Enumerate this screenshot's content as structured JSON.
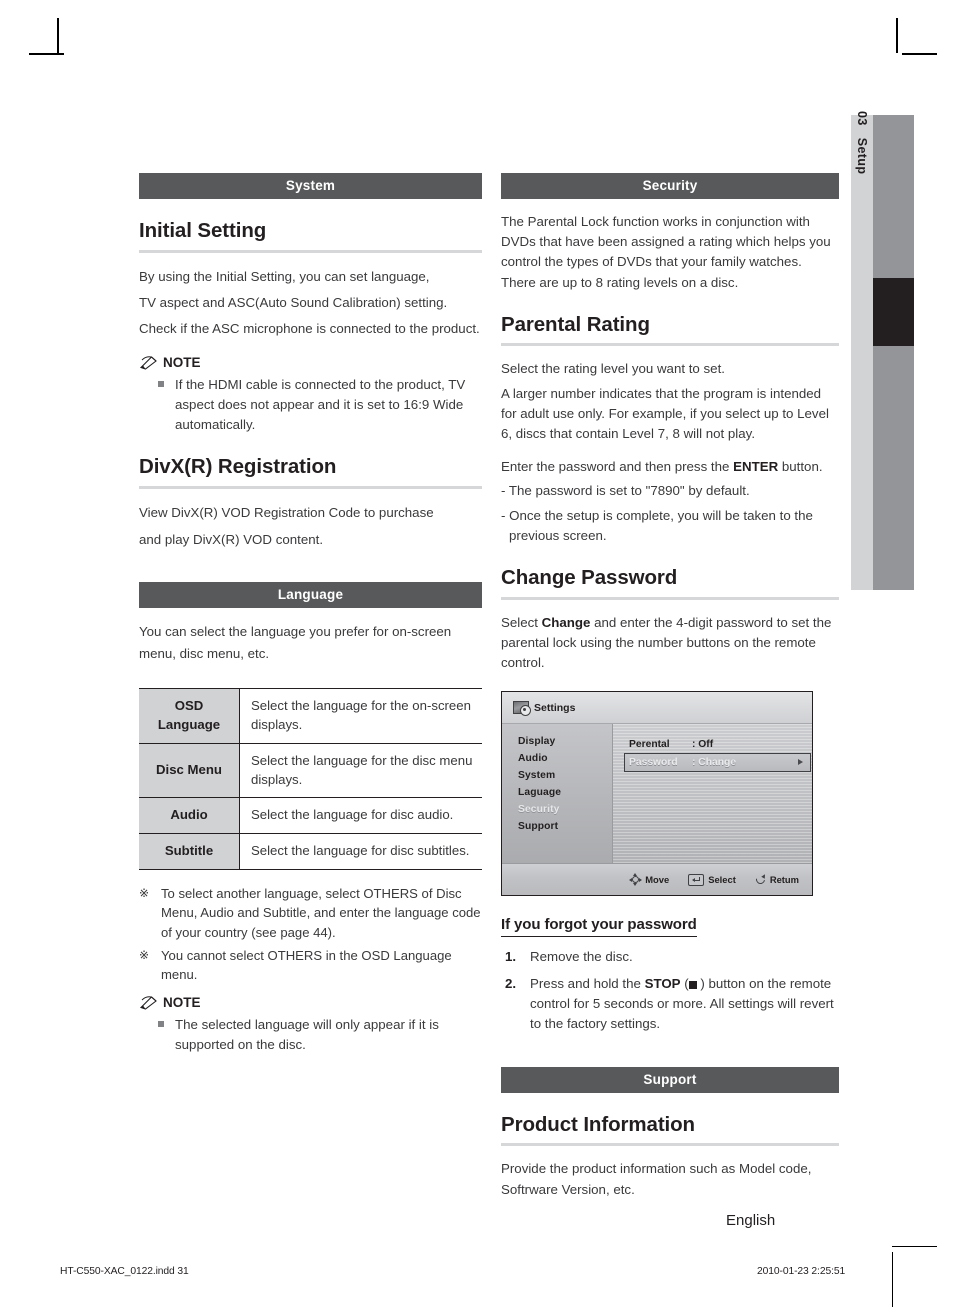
{
  "page": {
    "chapter_number": "03",
    "chapter_name": "Setup",
    "language_footer": "English",
    "print_file": "HT-C550-XAC_0122.indd   31",
    "print_stamp": "2010-01-23      2:25:51"
  },
  "left_column": {
    "system_bar": "System",
    "initial_setting": {
      "heading": "Initial Setting",
      "p1": "By using the Initial Setting, you can set language,",
      "p2": "TV aspect and ASC(Auto Sound Calibration) setting.",
      "p3": "Check if the ASC microphone is connected to the product.",
      "note_label": "NOTE",
      "note_items": [
        "If the HDMI cable is connected to the product, TV aspect does not appear and it is set to 16:9 Wide automatically."
      ]
    },
    "divx": {
      "heading": "DivX(R) Registration",
      "p1": "View DivX(R) VOD Registration Code to purchase",
      "p2": "and play DivX(R) VOD content."
    },
    "language_bar": "Language",
    "language": {
      "intro": "You can select the language you prefer for on-screen menu, disc menu, etc.",
      "table": [
        {
          "key": "OSD Language",
          "value": "Select the language for the on-screen displays."
        },
        {
          "key": "Disc Menu",
          "value": "Select the language for the disc menu displays."
        },
        {
          "key": "Audio",
          "value": "Select the language for disc audio."
        },
        {
          "key": "Subtitle",
          "value": "Select the language for disc subtitles."
        }
      ],
      "star_notes": [
        "To select another language, select OTHERS of Disc Menu, Audio and Subtitle, and enter the language code of your country (see page 44).",
        "You cannot select OTHERS in the OSD Language menu."
      ],
      "star_glyph": "※",
      "note_label": "NOTE",
      "note_items": [
        "The selected language will only appear if it is supported on the disc."
      ]
    }
  },
  "right_column": {
    "security_bar": "Security",
    "security_intro": "The Parental Lock function works in conjunction with DVDs that have been assigned a rating which helps you control the types of DVDs that your family watches. There are up to 8 rating levels on a disc.",
    "parental_rating": {
      "heading": "Parental Rating",
      "p1": "Select the rating level you want to set.",
      "p2": "A larger number indicates that the program is intended for adult use only. For example, if you select up to Level 6, discs that contain Level 7, 8 will not play.",
      "p3_pre": "Enter the password and then press the ",
      "p3_bold": "ENTER",
      "p3_post": " button.",
      "bullets": [
        "- The password is set to \"7890\" by default.",
        "- Once the setup is complete, you will be taken to the previous screen."
      ]
    },
    "change_password": {
      "heading": "Change Password",
      "p_pre": "Select ",
      "p_bold": "Change",
      "p_post": " and enter the 4-digit password to set the parental lock using the number buttons on the remote control."
    },
    "osd_screen": {
      "title": "Settings",
      "title_icon": "settings-image-gear-icon",
      "nav_items": [
        {
          "label": "Display",
          "selected": false
        },
        {
          "label": "Audio",
          "selected": false
        },
        {
          "label": "System",
          "selected": false
        },
        {
          "label": "Laguage",
          "selected": false
        },
        {
          "label": "Security",
          "selected": true
        },
        {
          "label": "Support",
          "selected": false
        }
      ],
      "rows": [
        {
          "key": "Perental",
          "value": ": Off",
          "highlighted": false
        },
        {
          "key": "Password",
          "value": ": Change",
          "highlighted": true
        }
      ],
      "footer_hints": [
        {
          "icon": "move-dpad-icon",
          "label": "Move"
        },
        {
          "icon": "enter-key-icon",
          "label": "Select"
        },
        {
          "icon": "return-arrow-icon",
          "label": "Retum"
        }
      ]
    },
    "forgot": {
      "heading": "If you forgot your password",
      "steps": [
        {
          "num": "1.",
          "text": "Remove the disc."
        },
        {
          "num": "2.",
          "pre": "Press and hold the ",
          "bold": "STOP",
          "post": " ) button on the remote control for 5 seconds or more. All settings will revert to the factory settings.",
          "icon": "stop-square-icon",
          "open_paren": " ("
        }
      ]
    },
    "support_bar": "Support",
    "product_information": {
      "heading": "Product Information",
      "p1": "Provide the product information such as Model code, Softrware Version, etc."
    }
  }
}
